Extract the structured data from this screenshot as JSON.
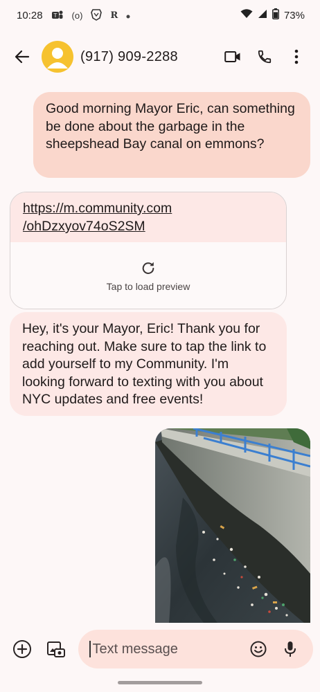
{
  "status_bar": {
    "time": "10:28",
    "left_icons": [
      "teams-icon",
      "nfc-icon",
      "brave-icon",
      "r-icon",
      "dot-icon"
    ],
    "nfc_label": "(o)",
    "r_label": "R",
    "battery": "73%"
  },
  "header": {
    "contact": "(917) 909-2288"
  },
  "messages": {
    "outgoing_text": "Good morning Mayor Eric, can something be done about the garbage in the sheepshead Bay canal on emmons?",
    "link_line1": "https://m.community.com",
    "link_line2": "/ohDzxyov74oS2SM",
    "preview_label": "Tap to load preview",
    "incoming_text": "Hey, it's your Mayor, Eric! Thank you for reaching out. Make sure to tap the link to add yourself to my Community. I'm looking forward to texting with you about NYC updates and free events!"
  },
  "composer": {
    "placeholder": "Text message"
  },
  "colors": {
    "outgoing_bubble": "#fad7cc",
    "incoming_bubble": "#fde8e6",
    "avatar": "#f6c22f",
    "background": "#fdf7f7"
  }
}
